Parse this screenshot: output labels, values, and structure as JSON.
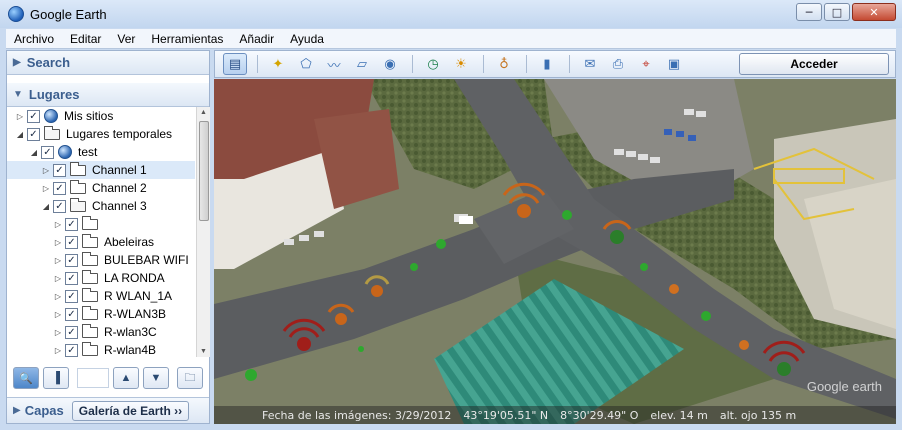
{
  "window": {
    "title": "Google Earth",
    "minimize": "─",
    "maximize": "□",
    "close": "✕"
  },
  "menu": [
    "Archivo",
    "Editar",
    "Ver",
    "Herramientas",
    "Añadir",
    "Ayuda"
  ],
  "search_panel": {
    "label": "Search"
  },
  "places_panel": {
    "label": "Lugares"
  },
  "tree": {
    "mis_sitios": "Mis sitios",
    "lugares_temporales": "Lugares temporales",
    "test": "test",
    "channel1": "Channel 1",
    "channel2": "Channel 2",
    "channel3": "Channel 3",
    "blank": "",
    "abeleiras": "Abeleiras",
    "bulebar": "BULEBAR WIFI",
    "la_ronda": "LA RONDA",
    "r_wlan_1a": "R WLAN_1A",
    "r_wlan3b": "R-WLAN3B",
    "r_wlan3c": "R-wlan3C",
    "r_wlan4b": "R-wlan4B"
  },
  "layers_panel": {
    "label": "Capas",
    "gallery_button": "Galería de Earth ››"
  },
  "toolbar": {
    "login_button": "Acceder"
  },
  "status": {
    "date_label": "Fecha de las imágenes: 3/29/2012",
    "lat": "43°19'05.51\" N",
    "lon": "8°30'29.49\" O",
    "elev": "elev.  14 m",
    "eye_alt": "alt. ojo  135 m"
  },
  "watermark": "Google earth",
  "colors": {
    "accent": "#3b5e8e",
    "selected_row": "#dbe9f9",
    "signal_green": "#2ea82e",
    "signal_orange": "#c8651a",
    "signal_red": "#a0201a"
  },
  "icons": [
    "earth-icon",
    "ruler-icon",
    "placemark-icon",
    "polygon-icon",
    "path-icon",
    "image-overlay-icon",
    "tour-icon",
    "history-icon",
    "sun-icon",
    "planet-icon",
    "email-icon",
    "print-icon",
    "maps-icon",
    "save-image-icon"
  ]
}
